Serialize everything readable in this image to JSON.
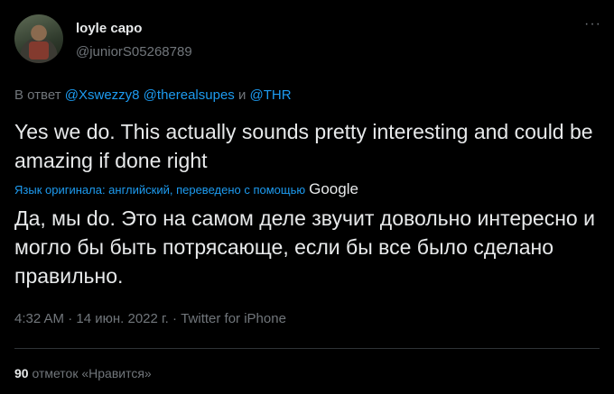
{
  "author": {
    "display_name": "loyle capo",
    "handle": "@juniorS05268789"
  },
  "more_label": "···",
  "reply": {
    "prefix": "В ответ",
    "mention_1": "@Xswezzy8",
    "mention_2": "@therealsupes",
    "conjunction": "и",
    "mention_3": "@THR"
  },
  "tweet": {
    "text": "Yes we do. This actually sounds pretty interesting and could be amazing if done right",
    "translation_note": "Язык оригинала: английский, переведено с помощью",
    "translation_provider": "Google",
    "translated_text": "Да, мы do. Это на самом деле звучит довольно интересно и могло бы быть потрясающе, если бы все было сделано правильно."
  },
  "meta": {
    "time": "4:32 AM",
    "separator": "·",
    "date": "14 июн. 2022 г.",
    "source": "Twitter for iPhone"
  },
  "stats": {
    "likes_count": "90",
    "likes_label": "отметок «Нравится»"
  },
  "colors": {
    "background": "#000000",
    "primary_text": "#e7e9ea",
    "secondary_text": "#71767b",
    "accent": "#1d9bf0"
  }
}
